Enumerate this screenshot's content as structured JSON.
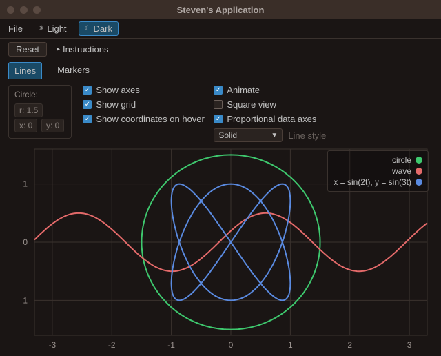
{
  "window": {
    "title": "Steven's Application"
  },
  "menu": {
    "file": "File",
    "theme_light": "Light",
    "theme_dark": "Dark",
    "theme_active": "dark"
  },
  "controls": {
    "reset": "Reset",
    "instructions": "Instructions"
  },
  "tabs": {
    "lines": "Lines",
    "markers": "Markers",
    "active": "lines"
  },
  "circle_panel": {
    "label": "Circle:",
    "r_label": "r: 1.5",
    "x_label": "x: 0",
    "y_label": "y: 0"
  },
  "checks": {
    "show_axes": {
      "label": "Show axes",
      "checked": true
    },
    "animate": {
      "label": "Animate",
      "checked": true
    },
    "show_grid": {
      "label": "Show grid",
      "checked": true
    },
    "square_view": {
      "label": "Square view",
      "checked": false
    },
    "show_coords": {
      "label": "Show coordinates on hover",
      "checked": true
    },
    "prop_axes": {
      "label": "Proportional data axes",
      "checked": true
    }
  },
  "line_style": {
    "selected": "Solid",
    "label": "Line style"
  },
  "legend": {
    "circle": "circle",
    "wave": "wave",
    "liss": "x = sin(2t), y = sin(3t)"
  },
  "colors": {
    "circle": "#3ec86e",
    "wave": "#e46a6a",
    "liss": "#5a8ae0",
    "accent": "#3a8ac8"
  },
  "chart_data": {
    "type": "line",
    "xlim": [
      -3.3,
      3.3
    ],
    "ylim": [
      -1.6,
      1.6
    ],
    "xticks": [
      -3,
      -2,
      -1,
      0,
      1,
      2,
      3
    ],
    "yticks": [
      -1,
      0,
      1
    ],
    "grid": true,
    "series": [
      {
        "name": "circle",
        "color": "#3ec86e",
        "parametric": {
          "x": "1.5*cos(t)",
          "y": "1.5*sin(t)",
          "t_range": [
            0,
            6.2832
          ]
        }
      },
      {
        "name": "wave",
        "color": "#e46a6a",
        "x_range": [
          -3.3,
          3.3
        ],
        "y_of_x": "0.5*sin(2*x + 0.4)"
      },
      {
        "name": "x = sin(2t), y = sin(3t)",
        "color": "#5a8ae0",
        "parametric": {
          "x": "sin(2*t)",
          "y": "sin(3*t)",
          "t_range": [
            0,
            6.2832
          ]
        }
      }
    ]
  }
}
